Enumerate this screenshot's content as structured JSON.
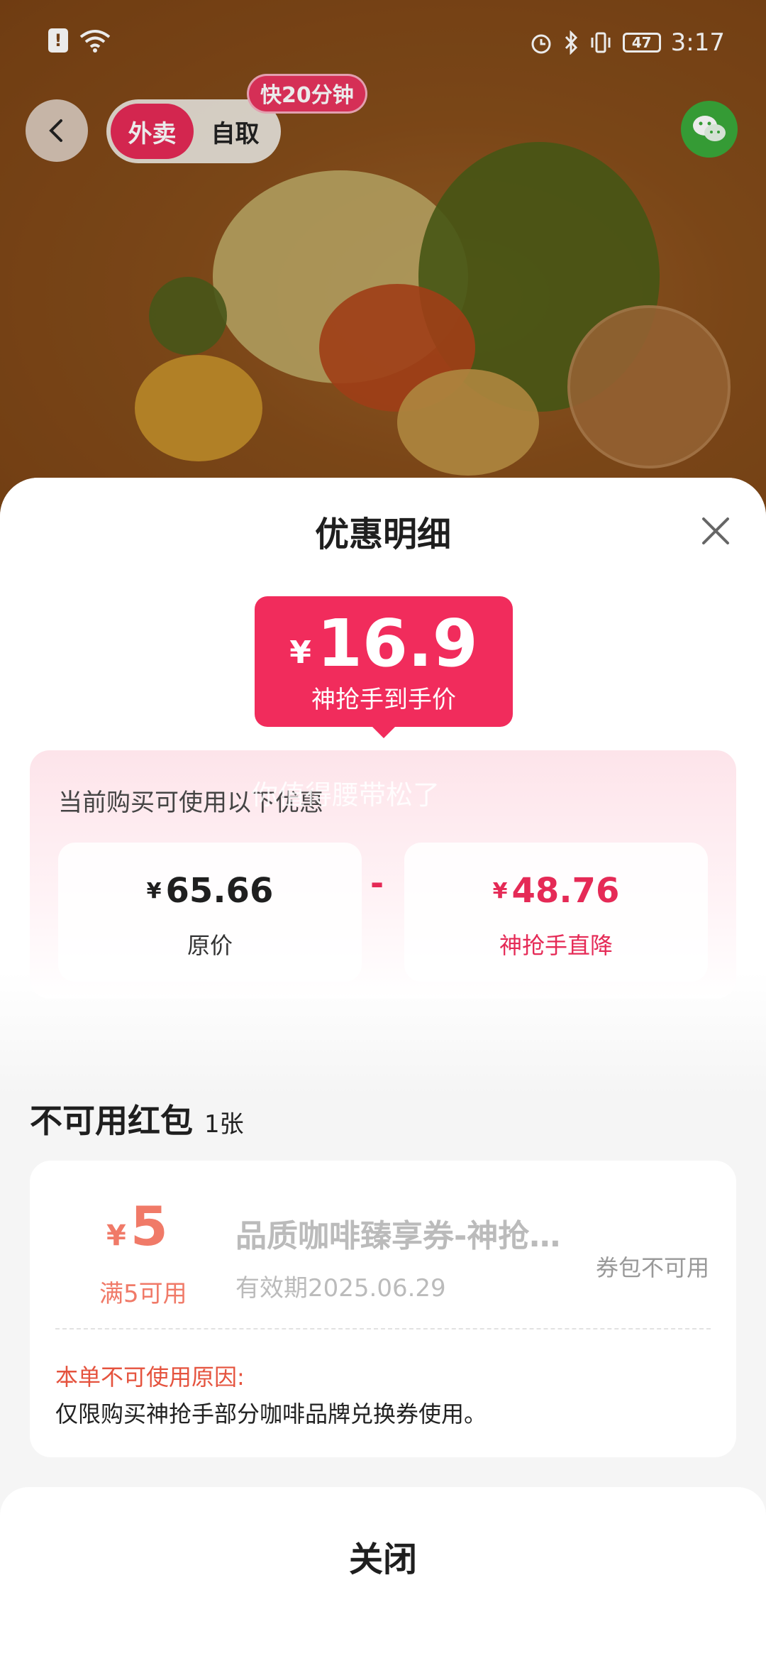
{
  "status_bar": {
    "time": "3:17",
    "battery": "47",
    "sim_glyph": "!"
  },
  "nav": {
    "mode_tabs": [
      "外卖",
      "自取"
    ],
    "active_mode": "外卖",
    "fast_tag": "快20分钟"
  },
  "sheet": {
    "title": "优惠明细",
    "final_price": {
      "currency": "¥",
      "amount": "16.9",
      "label": "神抢手到手价"
    },
    "discount_hint": "当前购买可使用以下优惠",
    "watermark": "你值得腰带松了",
    "original": {
      "currency": "¥",
      "amount": "65.66",
      "label": "原价"
    },
    "operator": "-",
    "reduction": {
      "currency": "¥",
      "amount": "48.76",
      "label": "神抢手直降"
    },
    "unusable": {
      "title": "不可用红包",
      "count": "1张"
    },
    "coupon": {
      "currency": "¥",
      "amount": "5",
      "condition": "满5可用",
      "name": "品质咖啡臻享券-神抢手部分咖啡品牌兑换券",
      "expiry": "有效期2025.06.29",
      "status": "券包不可用",
      "reason_title": "本单不可使用原因:",
      "reason": "仅限购买神抢手部分咖啡品牌兑换券使用。"
    },
    "close_label": "关闭"
  },
  "colors": {
    "accent": "#f12c5c",
    "coupon_red": "#f07a68",
    "reason_red": "#e5533e"
  }
}
